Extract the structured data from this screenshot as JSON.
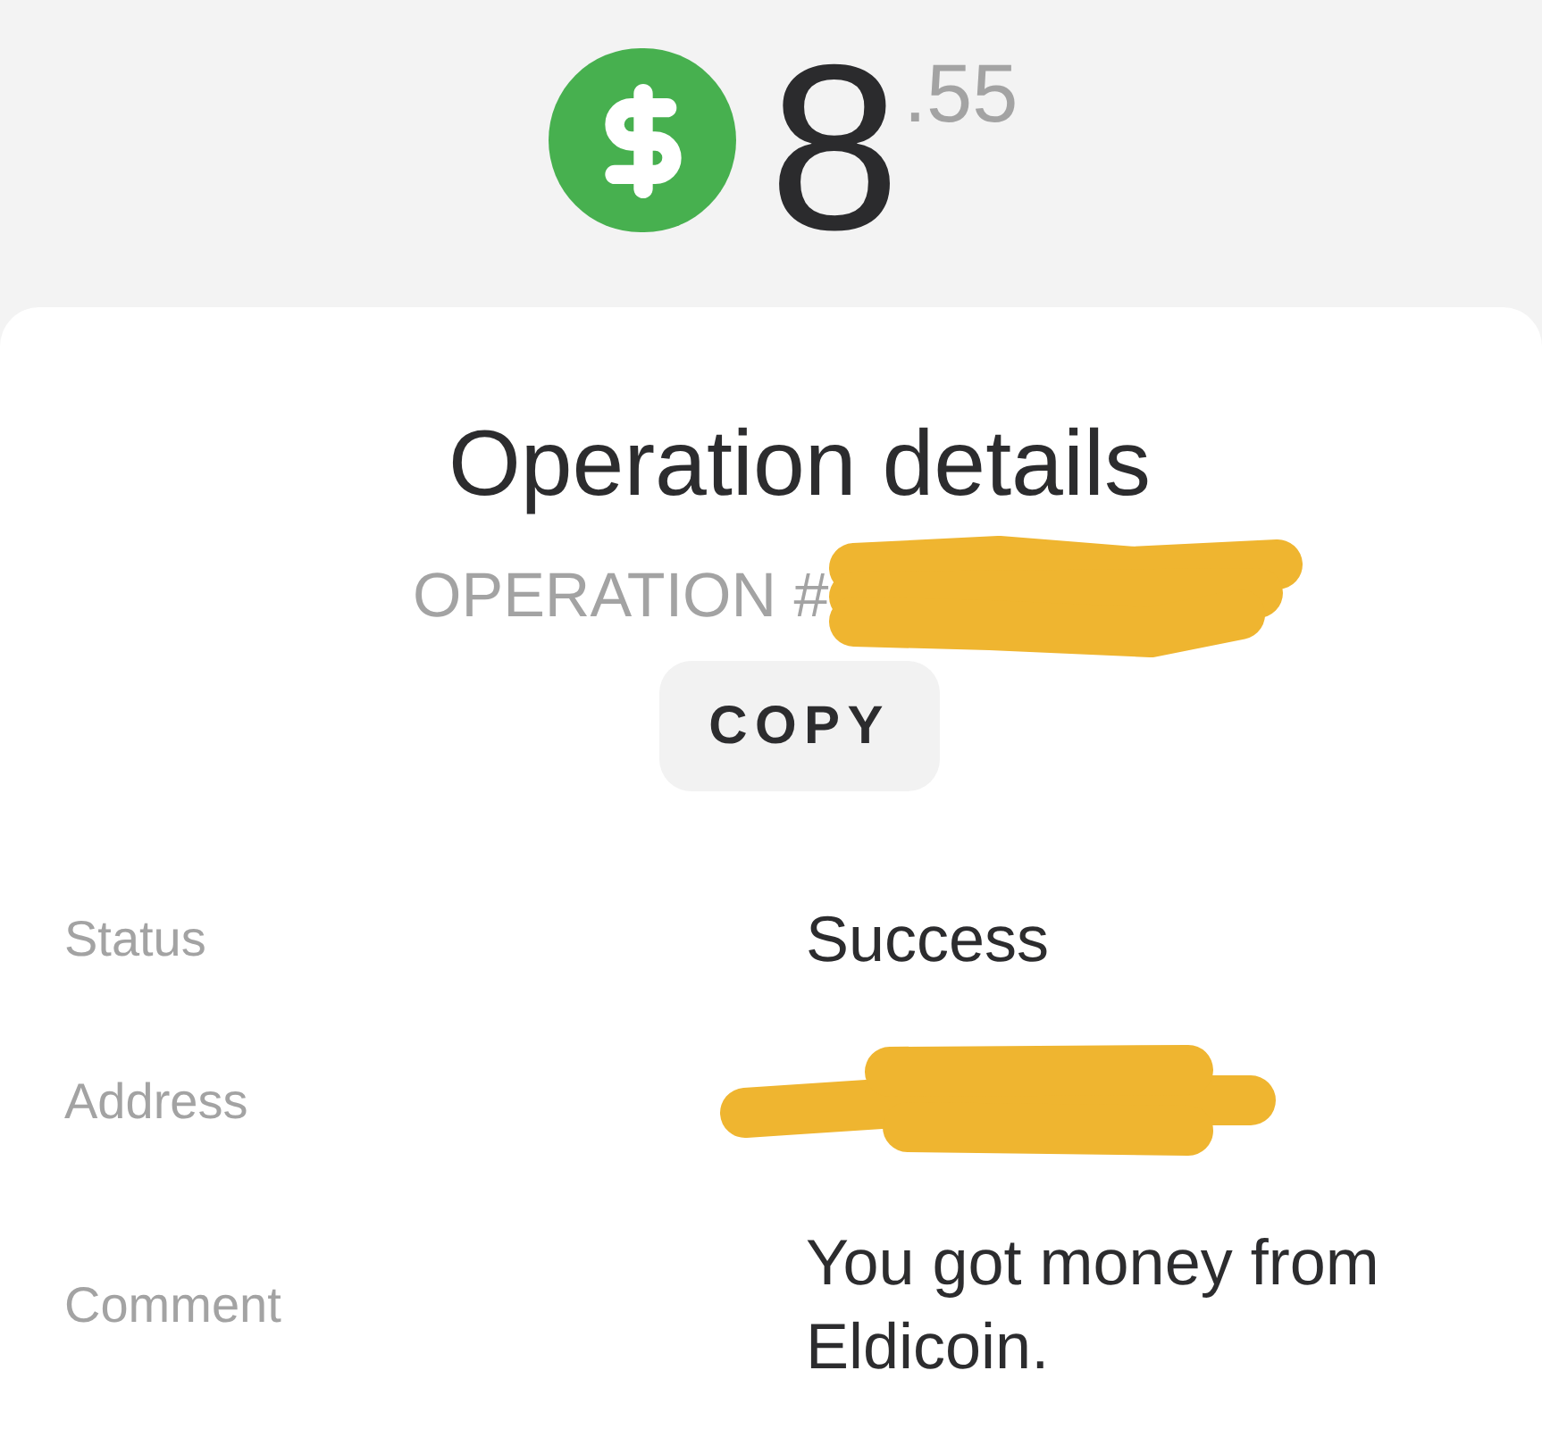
{
  "balance": {
    "integer": "8",
    "fraction": ".55"
  },
  "title": "Operation details",
  "operation": {
    "label": "OPERATION #",
    "number_redacted": true
  },
  "copy_button": "COPY",
  "details": [
    {
      "label": "Status",
      "value": "Success",
      "value_redacted": false
    },
    {
      "label": "Address",
      "value_redacted": true
    },
    {
      "label": "Comment",
      "value": "You got money from Eldicoin.",
      "value_redacted": false
    }
  ]
}
